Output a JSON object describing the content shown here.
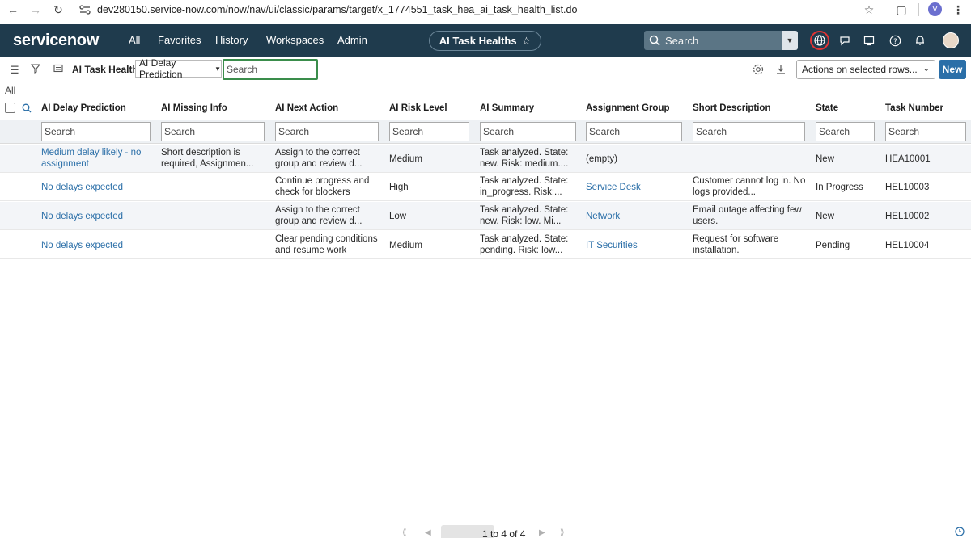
{
  "browser": {
    "url": "dev280150.service-now.com/now/nav/ui/classic/params/target/x_1774551_task_hea_ai_task_health_list.do",
    "profile_initial": "V"
  },
  "header": {
    "logo": "servicenow",
    "nav": [
      "All",
      "Favorites",
      "History",
      "Workspaces",
      "Admin"
    ],
    "context_title": "AI Task Healths",
    "search_placeholder": "Search"
  },
  "toolbar": {
    "title": "AI Task Healths",
    "field_select": "AI Delay Prediction",
    "search_value": "Search",
    "actions_select": "Actions on selected rows...",
    "new_label": "New"
  },
  "breadcrumb": "All",
  "table": {
    "columns": [
      "AI Delay Prediction",
      "AI Missing Info",
      "AI Next Action",
      "AI Risk Level",
      "AI Summary",
      "Assignment Group",
      "Short Description",
      "State",
      "Task Number"
    ],
    "search_placeholder": "Search",
    "rows": [
      {
        "delay": [
          "Medium delay likely - no",
          "assignment"
        ],
        "missing": [
          "Short description is",
          "required, Assignmen..."
        ],
        "next_action": [
          "Assign to the correct",
          "group and review d..."
        ],
        "risk": "Medium",
        "summary": [
          "Task analyzed. State:",
          "new. Risk: medium...."
        ],
        "group": "(empty)",
        "short_desc": [],
        "state": "New",
        "number": "HEA10001"
      },
      {
        "delay": [
          "No delays expected"
        ],
        "missing": [],
        "next_action": [
          "Continue progress and",
          "check for blockers"
        ],
        "risk": "High",
        "summary": [
          "Task analyzed. State:",
          "in_progress. Risk:..."
        ],
        "group": "Service Desk",
        "short_desc": [
          "Customer cannot log in. No",
          "logs provided..."
        ],
        "state": "In Progress",
        "number": "HEL10003"
      },
      {
        "delay": [
          "No delays expected"
        ],
        "missing": [],
        "next_action": [
          "Assign to the correct",
          "group and review d..."
        ],
        "risk": "Low",
        "summary": [
          "Task analyzed. State:",
          "new. Risk: low. Mi..."
        ],
        "group": "Network",
        "short_desc": [
          "Email outage affecting few",
          "users."
        ],
        "state": "New",
        "number": "HEL10002"
      },
      {
        "delay": [
          "No delays expected"
        ],
        "missing": [],
        "next_action": [
          "Clear pending conditions",
          "and resume work"
        ],
        "risk": "Medium",
        "summary": [
          "Task analyzed. State:",
          "pending. Risk: low..."
        ],
        "group": "IT Securities",
        "short_desc": [
          "Request for software",
          "installation."
        ],
        "state": "Pending",
        "number": "HEL10004"
      }
    ]
  },
  "pager": {
    "range": "1  to 4 of 4"
  },
  "colors": {
    "header_bg": "#1f3b4d",
    "link": "#2b6fa8",
    "new_button": "#2b6fa8",
    "search_focus": "#3a8d4b"
  }
}
